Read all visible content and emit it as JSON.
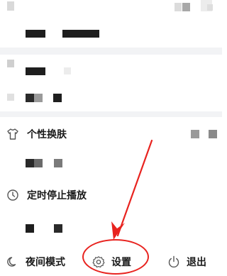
{
  "menu": {
    "items": [
      {
        "label": "个性换肤",
        "icon": "tshirt-icon"
      },
      {
        "label": "定时停止播放",
        "icon": "clock-icon"
      }
    ]
  },
  "bottom_bar": {
    "night_mode_label": "夜间模式",
    "night_mode_icon": "moon-icon",
    "settings_label": "设置",
    "settings_icon": "gear-icon",
    "logout_label": "退出",
    "logout_icon": "power-icon"
  },
  "colors": {
    "annotation": "#e8231f",
    "divider": "#f2f3f5",
    "text": "#1a1a1a",
    "icon": "#555555"
  }
}
